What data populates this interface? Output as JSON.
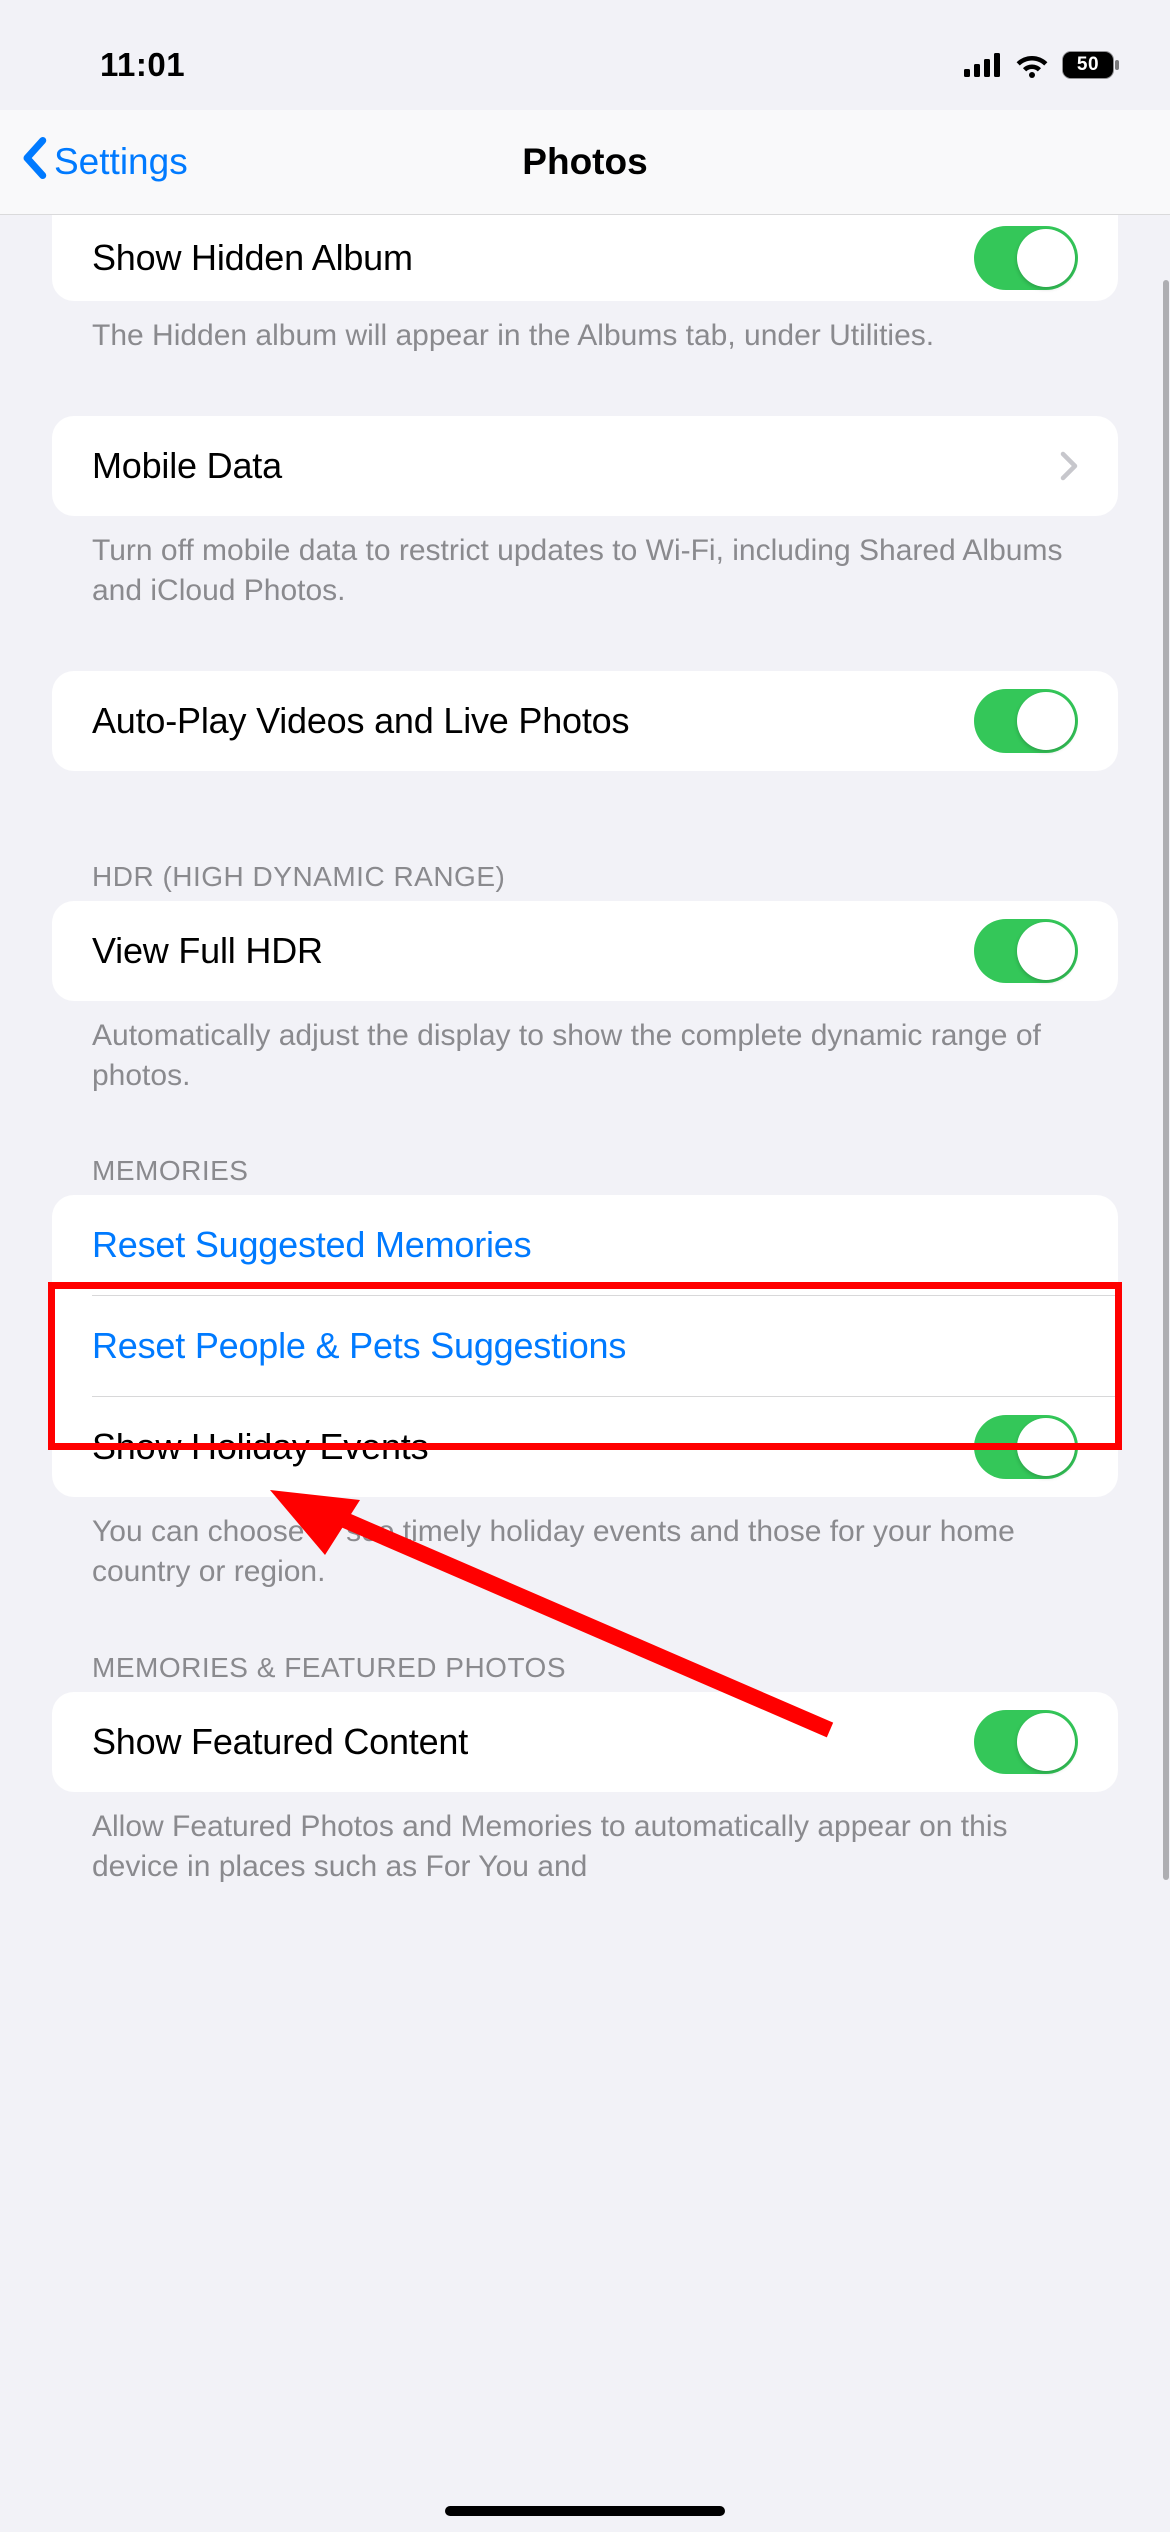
{
  "status_bar": {
    "time": "11:01",
    "battery_percent": "50"
  },
  "nav": {
    "back_label": "Settings",
    "title": "Photos"
  },
  "settings": {
    "hidden_album": {
      "label": "Show Hidden Album",
      "on": true,
      "footer": "The Hidden album will appear in the Albums tab, under Utilities."
    },
    "mobile_data": {
      "label": "Mobile Data",
      "footer": "Turn off mobile data to restrict updates to Wi-Fi, including Shared Albums and iCloud Photos."
    },
    "autoplay": {
      "label": "Auto-Play Videos and Live Photos",
      "on": true
    },
    "hdr_section": {
      "header": "HDR (HIGH DYNAMIC RANGE)",
      "view_full_hdr": {
        "label": "View Full HDR",
        "on": true
      },
      "footer": "Automatically adjust the display to show the complete dynamic range of photos."
    },
    "memories_section": {
      "header": "MEMORIES",
      "reset_memories": {
        "label": "Reset Suggested Memories"
      },
      "reset_people": {
        "label": "Reset People & Pets Suggestions"
      },
      "holiday": {
        "label": "Show Holiday Events",
        "on": true
      },
      "footer": "You can choose to see timely holiday events and those for your home country or region."
    },
    "featured_section": {
      "header": "MEMORIES & FEATURED PHOTOS",
      "featured": {
        "label": "Show Featured Content",
        "on": true
      },
      "footer": "Allow Featured Photos and Memories to automatically appear on this device in places such as For You and"
    }
  }
}
